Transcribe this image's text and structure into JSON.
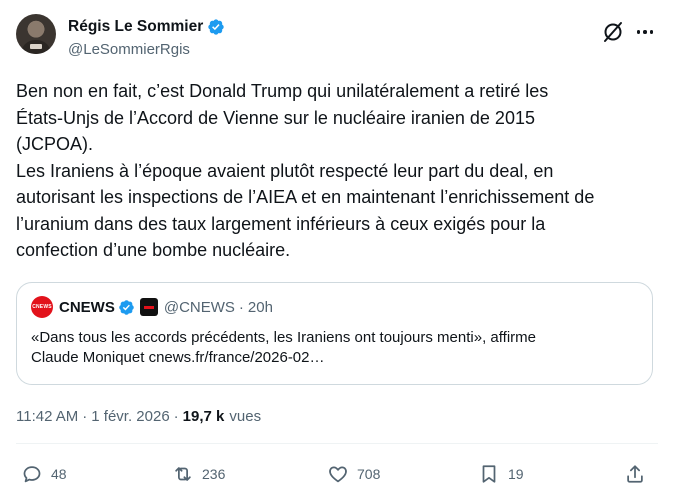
{
  "author": {
    "display_name": "Régis Le Sommier",
    "handle": "@LeSommierRgis",
    "verified": true
  },
  "tweet": {
    "lines": [
      "Ben non en fait, c’est Donald Trump qui unilatéralement a retiré les",
      "États-Unjs de l’Accord de Vienne sur le nucléaire iranien de 2015",
      "(JCPOA).",
      "Les Iraniens à l’époque avaient plutôt respecté leur part du deal, en",
      "autorisant les inspections de l’AIEA et en maintenant l’enrichissement de",
      "l’uranium dans des taux largement inférieurs à ceux exigés pour la",
      "confection d’une bombe nucléaire."
    ]
  },
  "quote": {
    "display_name": "CNEWS",
    "logo_text": "CNEWS",
    "handle": "@CNEWS",
    "separator": "·",
    "time": "20h",
    "lines": [
      "«Dans tous les accords précédents, les Iraniens ont toujours menti», affirme",
      "Claude Moniquet cnews.fr/france/2026-02…"
    ]
  },
  "meta": {
    "time": "11:42 AM",
    "separator": "·",
    "date": "1 févr. 2026",
    "views_count": "19,7 k",
    "views_label": "vues"
  },
  "actions": {
    "replies": "48",
    "reposts": "236",
    "likes": "708",
    "bookmarks": "19"
  },
  "icons": {
    "verified": "verified-badge-icon",
    "grok": "grok-icon",
    "more": "more-icon",
    "reply": "reply-icon",
    "repost": "repost-icon",
    "like": "heart-icon",
    "bookmark": "bookmark-icon",
    "share": "share-icon"
  },
  "colors": {
    "text": "#0f1419",
    "secondary": "#536471",
    "verified_blue": "#1d9bf0",
    "border": "#cfd9de",
    "cnews_red": "#e2121b"
  }
}
